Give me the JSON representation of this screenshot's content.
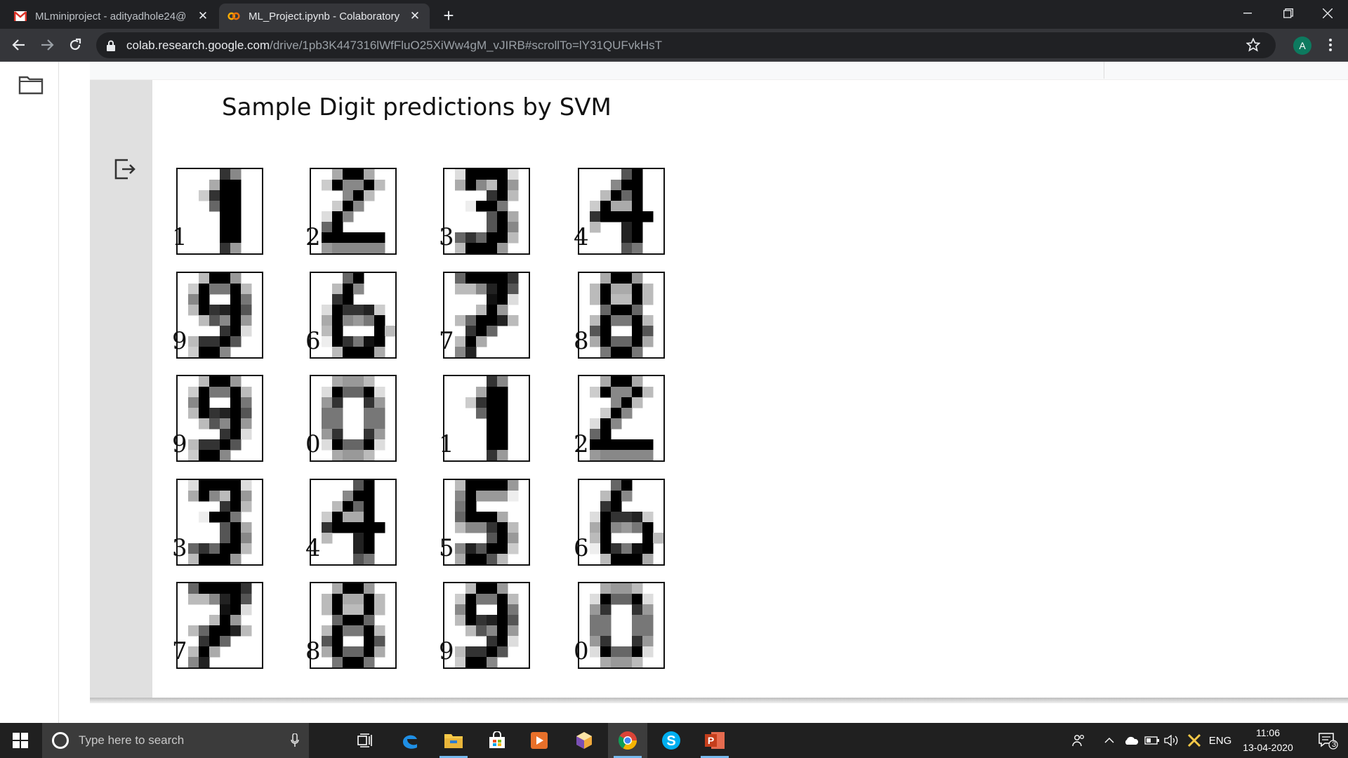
{
  "browser": {
    "tabs": [
      {
        "title": "MLminiproject - adityadhole24@",
        "icon": "gmail-icon",
        "active": false
      },
      {
        "title": "ML_Project.ipynb - Colaboratory",
        "icon": "colab-icon",
        "active": true
      }
    ],
    "url_host": "colab.research.google.com",
    "url_path": "/drive/1pb3K447316lWfFluO25XiWw4gM_vJIRB#scrollTo=lY31QUFvkHsT",
    "profile_initial": "A"
  },
  "figure": {
    "title": "Sample Digit predictions by SVM",
    "digits": [
      {
        "label": "1"
      },
      {
        "label": "2"
      },
      {
        "label": "3"
      },
      {
        "label": "4"
      },
      {
        "label": "9"
      },
      {
        "label": "6"
      },
      {
        "label": "7"
      },
      {
        "label": "8"
      },
      {
        "label": "9"
      },
      {
        "label": "0"
      },
      {
        "label": "1"
      },
      {
        "label": "2"
      },
      {
        "label": "3"
      },
      {
        "label": "4"
      },
      {
        "label": "5"
      },
      {
        "label": "6"
      },
      {
        "label": "7"
      },
      {
        "label": "8"
      },
      {
        "label": "9"
      },
      {
        "label": "0"
      }
    ]
  },
  "taskbar": {
    "search_placeholder": "Type here to search",
    "language": "ENG",
    "time": "11:06",
    "date": "13-04-2020",
    "notification_count": "3",
    "apps": [
      "task-view-icon",
      "edge-icon",
      "file-explorer-icon",
      "store-icon",
      "media-player-icon",
      "cube-app-icon",
      "chrome-icon",
      "skype-icon",
      "powerpoint-icon"
    ]
  }
}
